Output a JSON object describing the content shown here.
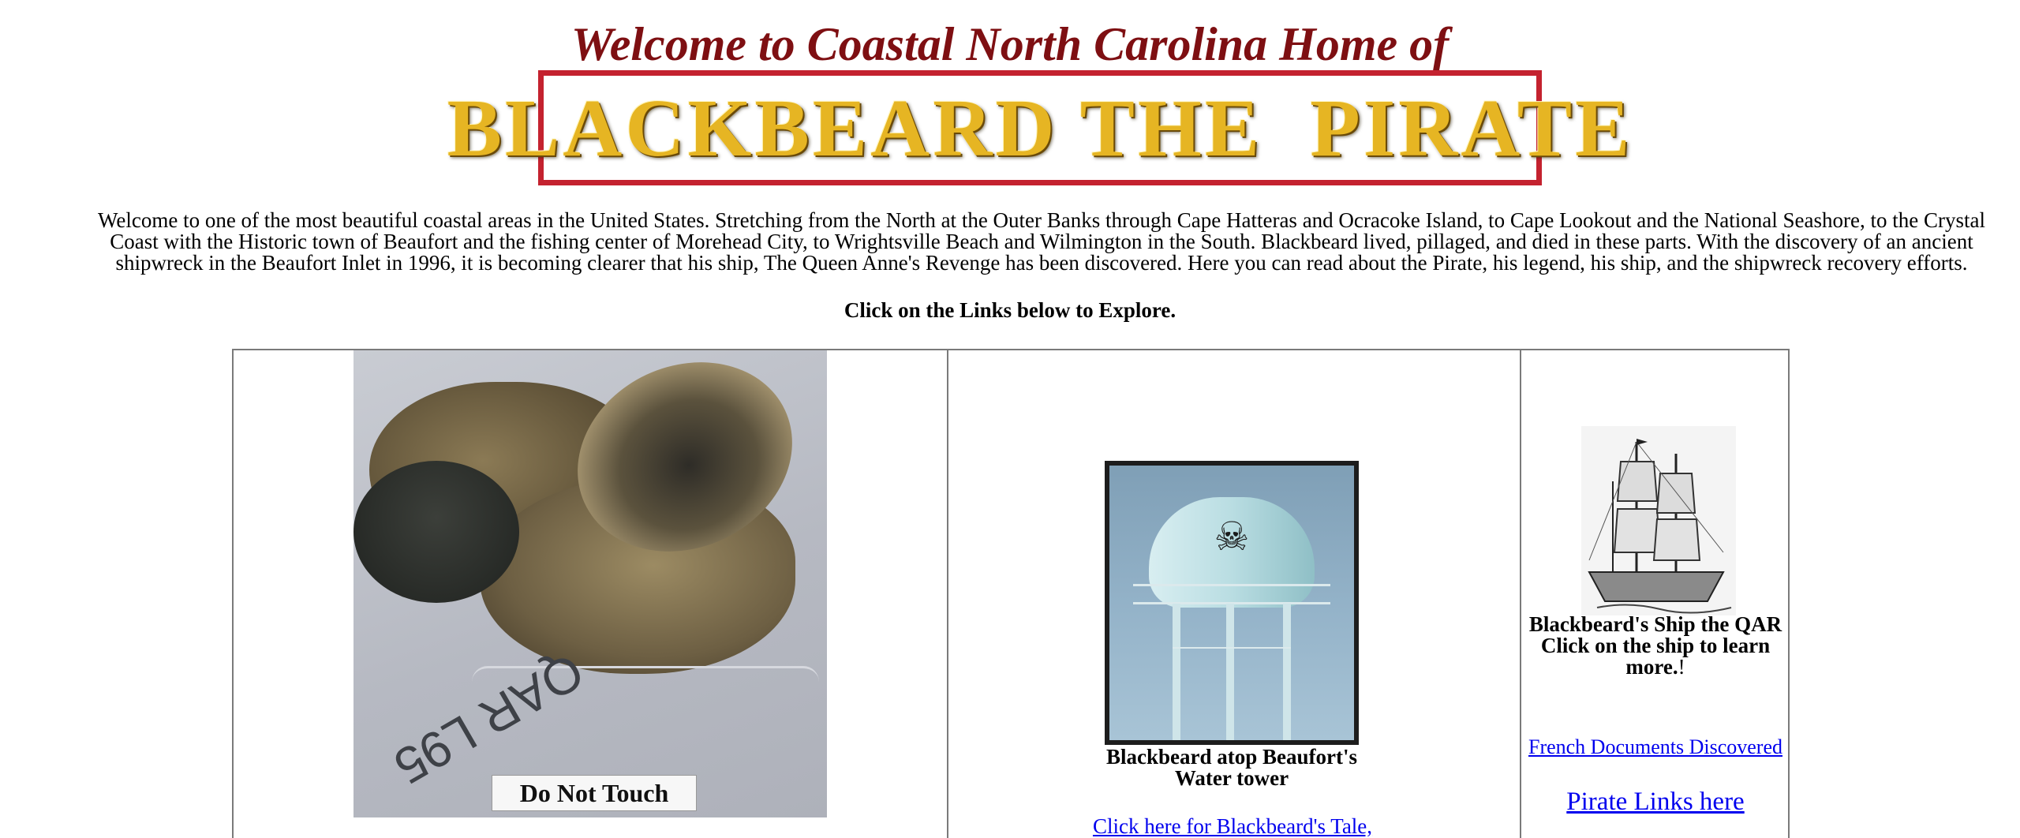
{
  "header": {
    "welcome": "Welcome to Coastal North Carolina Home of",
    "banner_text": "BLACKBEARD THE  PIRATE"
  },
  "intro": {
    "paragraph": "Welcome to one of the most beautiful coastal areas in the United States.  Stretching from  the North at the Outer Banks  through Cape Hatteras and Ocracoke Island, to Cape Lookout and the National Seashore, to the Crystal Coast with the Historic town of  Beaufort and the fishing center of Morehead City, to Wrightsville Beach and Wilmington in the South. Blackbeard lived, pillaged, and died in these parts.   With the discovery of an ancient shipwreck in the Beaufort Inlet in 1996, it is becoming clearer that his ship, The Queen Anne's Revenge has been discovered.  Here you can read about the Pirate, his legend, his ship, and the shipwreck recovery efforts.",
    "explore": "Click on the Links below to Explore."
  },
  "artifact": {
    "scrawl": "QAR L95",
    "sign": "Do Not Touch"
  },
  "tower": {
    "caption": "Blackbeard atop Beaufort's Water tower",
    "tale_link": "Click here for Blackbeard's Tale,"
  },
  "ship": {
    "caption": "Blackbeard's Ship the QAR Click on the ship to learn more.",
    "caption_suffix": "!",
    "french_link": "French Documents Discovered",
    "pirate_link": "Pirate Links here"
  },
  "colors": {
    "heading": "#7e0f12",
    "banner_border": "#c4222f",
    "banner_letters": "#e6b523",
    "link": "#0000ee"
  }
}
